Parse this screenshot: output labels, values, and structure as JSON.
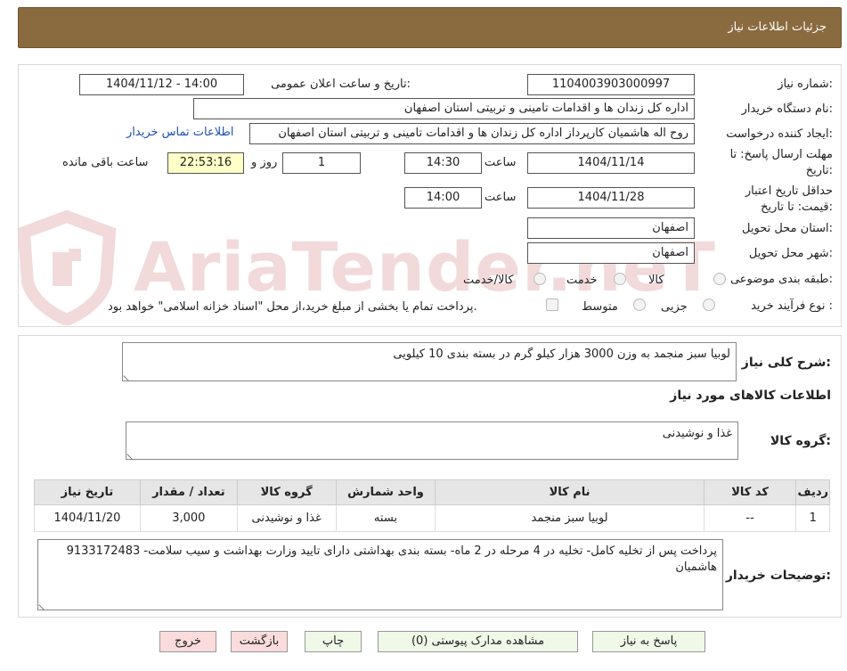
{
  "header": {
    "title": "جزئيات اطلاعات نياز"
  },
  "form": {
    "need_number_label": "شماره نیاز:",
    "need_number": "1104003903000997",
    "announce_label": "تاریخ و ساعت اعلان عمومی:",
    "announce_value": "1404/11/12 - 14:00",
    "buyer_org_label": "نام دستگاه خریدار:",
    "buyer_org": "اداره کل زندان ها و اقدامات تامینی و تربیتی استان اصفهان",
    "creator_label": "ایجاد کننده درخواست:",
    "creator": "روح اله هاشمیان کارپرداز اداره کل زندان ها و اقدامات تامینی و تربیتی استان اصفهان",
    "contact_link": "اطلاعات تماس خریدار",
    "deadline_label_1": "مهلت ارسال پاسخ: تا",
    "deadline_label_2": "تاریخ:",
    "deadline_date": "1404/11/14",
    "time_label": "ساعت",
    "deadline_time": "14:30",
    "days_value": "1",
    "days_label": "روز و",
    "remaining_time": "22:53:16",
    "remaining_label": "ساعت باقی مانده",
    "validity_label_1": "حداقل تاریخ اعتبار",
    "validity_label_2": "قیمت: تا تاریخ:",
    "validity_date": "1404/11/28",
    "validity_time": "14:00",
    "province_label": "استان محل تحویل:",
    "province": "اصفهان",
    "city_label": "شهر محل تحویل:",
    "city": "اصفهان",
    "category_label": "طبقه بندی موضوعی:",
    "category_options": [
      "کالا",
      "خدمت",
      "کالا/خدمت"
    ],
    "process_label": "نوع فرآیند خرید :",
    "process_options": [
      "جزیی",
      "متوسط"
    ],
    "payment_note": "پرداخت تمام یا بخشی از مبلغ خرید،از محل \"اسناد خزانه اسلامی\" خواهد بود."
  },
  "summary": {
    "title_label": "شرح کلی نیاز:",
    "title_value": "لوبیا سبز منجمد به وزن 3000 هزار کیلو گرم در بسته بندی 10 کیلویی",
    "section_title": "اطلاعات کالاهای مورد نیاز",
    "group_label": "گروه کالا:",
    "group_value": "غذا و نوشیدنی"
  },
  "table": {
    "headers": [
      "ردیف",
      "کد کالا",
      "نام کالا",
      "واحد شمارش",
      "گروه کالا",
      "تعداد / مقدار",
      "تاریخ نیاز"
    ],
    "rows": [
      [
        "1",
        "--",
        "لوبیا سبز منجمد",
        "بسته",
        "غذا و نوشیدنی",
        "3,000",
        "1404/11/20"
      ]
    ]
  },
  "notes": {
    "label": "توضیحات خریدار:",
    "value": "پرداخت پس از تخلیه کامل- تخلیه در 4 مرحله در 2 ماه- بسته بندی بهداشتی دارای تایید وزارت بهداشت و سیب سلامت- 9133172483 هاشمیان"
  },
  "buttons": {
    "reply": "پاسخ به نياز",
    "attachments": "مشاهده مدارک پیوستی (0)",
    "print": "چاپ",
    "back": "بازگشت",
    "exit": "خروج"
  },
  "watermark": {
    "text": "AriaTender.neT"
  }
}
